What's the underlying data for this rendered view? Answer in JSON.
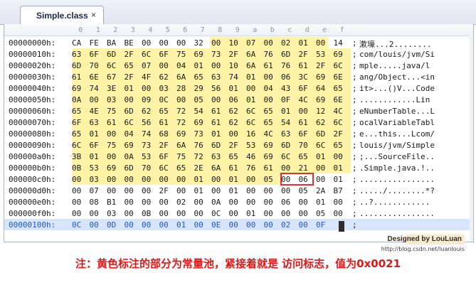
{
  "tab": {
    "title": "Simple.class",
    "close_glyph": "×"
  },
  "ruler": [
    "0",
    "1",
    "2",
    "3",
    "4",
    "5",
    "6",
    "7",
    "8",
    "9",
    "a",
    "b",
    "c",
    "d",
    "e",
    "f"
  ],
  "rows": [
    {
      "offset": "00000000h:",
      "bytes": [
        "CA",
        "FE",
        "BA",
        "BE",
        "00",
        "00",
        "00",
        "32",
        "00",
        "10",
        "07",
        "00",
        "02",
        "01",
        "00",
        "14"
      ],
      "ascii": "漱壕...2........"
    },
    {
      "offset": "00000010h:",
      "bytes": [
        "63",
        "6F",
        "6D",
        "2F",
        "6C",
        "6F",
        "75",
        "69",
        "73",
        "2F",
        "6A",
        "76",
        "6D",
        "2F",
        "53",
        "69"
      ],
      "ascii": "com/louis/jvm/Si"
    },
    {
      "offset": "00000020h:",
      "bytes": [
        "6D",
        "70",
        "6C",
        "65",
        "07",
        "00",
        "04",
        "01",
        "00",
        "10",
        "6A",
        "61",
        "76",
        "61",
        "2F",
        "6C"
      ],
      "ascii": "mple.....java/l"
    },
    {
      "offset": "00000030h:",
      "bytes": [
        "61",
        "6E",
        "67",
        "2F",
        "4F",
        "62",
        "6A",
        "65",
        "63",
        "74",
        "01",
        "00",
        "06",
        "3C",
        "69",
        "6E"
      ],
      "ascii": "ang/Object...<in"
    },
    {
      "offset": "00000040h:",
      "bytes": [
        "69",
        "74",
        "3E",
        "01",
        "00",
        "03",
        "28",
        "29",
        "56",
        "01",
        "00",
        "04",
        "43",
        "6F",
        "64",
        "65"
      ],
      "ascii": "it>...()V...Code"
    },
    {
      "offset": "00000050h:",
      "bytes": [
        "0A",
        "00",
        "03",
        "00",
        "09",
        "0C",
        "00",
        "05",
        "00",
        "06",
        "01",
        "00",
        "0F",
        "4C",
        "69",
        "6E"
      ],
      "ascii": "............Lin"
    },
    {
      "offset": "00000060h:",
      "bytes": [
        "65",
        "4E",
        "75",
        "6D",
        "62",
        "65",
        "72",
        "54",
        "61",
        "62",
        "6C",
        "65",
        "01",
        "00",
        "12",
        "4C"
      ],
      "ascii": "eNumberTable...L"
    },
    {
      "offset": "00000070h:",
      "bytes": [
        "6F",
        "63",
        "61",
        "6C",
        "56",
        "61",
        "72",
        "69",
        "61",
        "62",
        "6C",
        "65",
        "54",
        "61",
        "62",
        "6C"
      ],
      "ascii": "ocalVariableTabl"
    },
    {
      "offset": "00000080h:",
      "bytes": [
        "65",
        "01",
        "00",
        "04",
        "74",
        "68",
        "69",
        "73",
        "01",
        "00",
        "16",
        "4C",
        "63",
        "6F",
        "6D",
        "2F"
      ],
      "ascii": "e...this...Lcom/"
    },
    {
      "offset": "00000090h:",
      "bytes": [
        "6C",
        "6F",
        "75",
        "69",
        "73",
        "2F",
        "6A",
        "76",
        "6D",
        "2F",
        "53",
        "69",
        "6D",
        "70",
        "6C",
        "65"
      ],
      "ascii": "louis/jvm/Simple"
    },
    {
      "offset": "000000a0h:",
      "bytes": [
        "3B",
        "01",
        "00",
        "0A",
        "53",
        "6F",
        "75",
        "72",
        "63",
        "65",
        "46",
        "69",
        "6C",
        "65",
        "01",
        "00"
      ],
      "ascii": ";...SourceFile.."
    },
    {
      "offset": "000000b0h:",
      "bytes": [
        "0B",
        "53",
        "69",
        "6D",
        "70",
        "6C",
        "65",
        "2E",
        "6A",
        "61",
        "76",
        "61",
        "00",
        "21",
        "00",
        "01"
      ],
      "ascii": ".Simple.java.!.."
    },
    {
      "offset": "000000c0h:",
      "bytes": [
        "00",
        "03",
        "00",
        "00",
        "00",
        "00",
        "00",
        "01",
        "00",
        "01",
        "00",
        "05",
        "00",
        "06",
        "00",
        "01"
      ],
      "ascii": "................"
    },
    {
      "offset": "000000d0h:",
      "bytes": [
        "00",
        "07",
        "00",
        "00",
        "00",
        "2F",
        "00",
        "01",
        "00",
        "01",
        "00",
        "00",
        "00",
        "05",
        "2A",
        "B7"
      ],
      "ascii": "...../........*?"
    },
    {
      "offset": "000000e0h:",
      "bytes": [
        "00",
        "08",
        "B1",
        "00",
        "00",
        "00",
        "02",
        "00",
        "0A",
        "00",
        "00",
        "00",
        "06",
        "00",
        "01",
        "00"
      ],
      "ascii": "..?............"
    },
    {
      "offset": "000000f0h:",
      "bytes": [
        "00",
        "00",
        "03",
        "00",
        "0B",
        "00",
        "00",
        "00",
        "0C",
        "00",
        "01",
        "00",
        "00",
        "00",
        "05",
        "00"
      ],
      "ascii": "................"
    },
    {
      "offset": "00000100h:",
      "bytes": [
        "0C",
        "00",
        "0D",
        "00",
        "00",
        "00",
        "01",
        "00",
        "0E",
        "00",
        "00",
        "00",
        "02",
        "00",
        "0F"
      ],
      "ascii": ""
    }
  ],
  "ascii_separator": ";",
  "signature": {
    "title": "Designed by LouLuan",
    "url": "http://blog.csdn.net/luanlouis"
  },
  "caption": "注：黄色标注的部分为常量池，紧接着就是 访问标志，值为0x0021",
  "colors": {
    "highlight": "#fdf3a6",
    "box": "#e23030",
    "caption": "#e01818",
    "current_row": "#d7e6fb"
  }
}
